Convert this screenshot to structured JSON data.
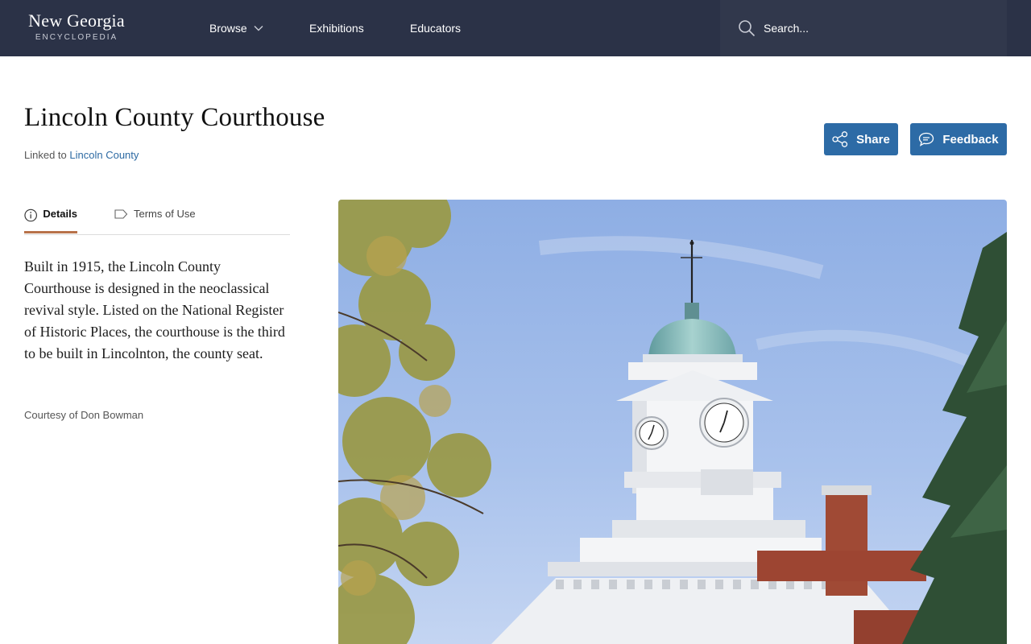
{
  "header": {
    "logo_main": "New Georgia",
    "logo_sub": "ENCYCLOPEDIA",
    "nav": {
      "browse": "Browse",
      "exhibitions": "Exhibitions",
      "educators": "Educators"
    },
    "search_placeholder": "Search..."
  },
  "page": {
    "title": "Lincoln County Courthouse",
    "linked_prefix": "Linked to",
    "linked_link": "Lincoln County",
    "share_label": "Share",
    "feedback_label": "Feedback"
  },
  "tabs": {
    "details": "Details",
    "terms": "Terms of Use"
  },
  "content": {
    "description": "Built in 1915, the Lincoln County Courthouse is designed in the neoclassical revival style. Listed on the National Register of Historic Places, the courthouse is the third to be built in Lincolnton, the county seat.",
    "credit": "Courtesy of Don Bowman"
  },
  "colors": {
    "header_bg": "#2b3247",
    "button_bg": "#2d6ba6",
    "link": "#2d6aa3",
    "tab_accent": "#b8724a"
  },
  "icons": [
    "chevron-down-icon",
    "search-icon",
    "share-icon",
    "feedback-icon",
    "info-icon",
    "tag-icon"
  ]
}
